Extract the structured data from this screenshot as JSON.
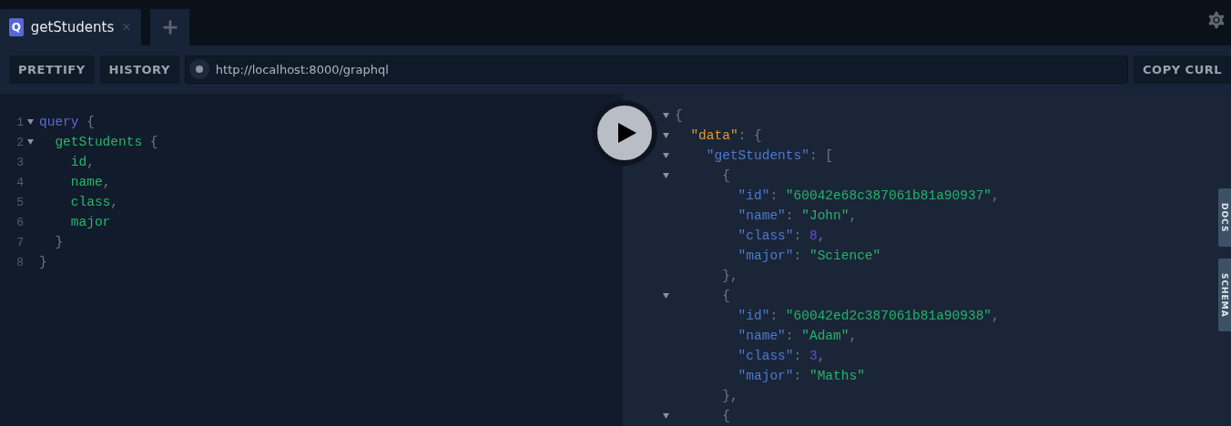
{
  "tabs": [
    {
      "badge": "Q",
      "label": "getStudents",
      "selected": true
    }
  ],
  "toolbar": {
    "buttons": [
      "PRETTIFY",
      "HISTORY"
    ],
    "url": "http://localhost:8000/graphql",
    "copy_button": "COPY CURL"
  },
  "query_editor": {
    "lines": [
      {
        "number": "1",
        "fold": true,
        "tokens": [
          {
            "kind": "keyword",
            "text": "query"
          },
          {
            "kind": "punct",
            "text": " {"
          }
        ]
      },
      {
        "number": "2",
        "fold": true,
        "tokens": [
          {
            "kind": "field",
            "text": "  getStudents"
          },
          {
            "kind": "punct",
            "text": " {"
          }
        ]
      },
      {
        "number": "3",
        "fold": false,
        "tokens": [
          {
            "kind": "field",
            "text": "    id"
          },
          {
            "kind": "punct",
            "text": ","
          }
        ]
      },
      {
        "number": "4",
        "fold": false,
        "tokens": [
          {
            "kind": "field",
            "text": "    name"
          },
          {
            "kind": "punct",
            "text": ","
          }
        ]
      },
      {
        "number": "5",
        "fold": false,
        "tokens": [
          {
            "kind": "field",
            "text": "    class"
          },
          {
            "kind": "punct",
            "text": ","
          }
        ]
      },
      {
        "number": "6",
        "fold": false,
        "tokens": [
          {
            "kind": "field",
            "text": "    major"
          }
        ]
      },
      {
        "number": "7",
        "fold": false,
        "tokens": [
          {
            "kind": "punct",
            "text": "  }"
          }
        ]
      },
      {
        "number": "8",
        "fold": false,
        "tokens": [
          {
            "kind": "punct",
            "text": "}"
          }
        ]
      }
    ]
  },
  "response": {
    "lines": [
      {
        "fold": true,
        "tokens": [
          {
            "kind": "punct",
            "text": "{"
          }
        ]
      },
      {
        "fold": true,
        "tokens": [
          {
            "kind": "rootkey",
            "text": "  \"data\""
          },
          {
            "kind": "punct",
            "text": ": {"
          }
        ]
      },
      {
        "fold": true,
        "tokens": [
          {
            "kind": "key",
            "text": "    \"getStudents\""
          },
          {
            "kind": "punct",
            "text": ": ["
          }
        ]
      },
      {
        "fold": true,
        "tokens": [
          {
            "kind": "punct",
            "text": "      {"
          }
        ]
      },
      {
        "fold": false,
        "tokens": [
          {
            "kind": "key",
            "text": "        \"id\""
          },
          {
            "kind": "punct",
            "text": ": "
          },
          {
            "kind": "string",
            "text": "\"60042e68c387061b81a90937\""
          },
          {
            "kind": "punct",
            "text": ","
          }
        ]
      },
      {
        "fold": false,
        "tokens": [
          {
            "kind": "key",
            "text": "        \"name\""
          },
          {
            "kind": "punct",
            "text": ": "
          },
          {
            "kind": "string",
            "text": "\"John\""
          },
          {
            "kind": "punct",
            "text": ","
          }
        ]
      },
      {
        "fold": false,
        "tokens": [
          {
            "kind": "key",
            "text": "        \"class\""
          },
          {
            "kind": "punct",
            "text": ": "
          },
          {
            "kind": "number",
            "text": "8"
          },
          {
            "kind": "punct",
            "text": ","
          }
        ]
      },
      {
        "fold": false,
        "tokens": [
          {
            "kind": "key",
            "text": "        \"major\""
          },
          {
            "kind": "punct",
            "text": ": "
          },
          {
            "kind": "string",
            "text": "\"Science\""
          }
        ]
      },
      {
        "fold": false,
        "tokens": [
          {
            "kind": "punct",
            "text": "      },"
          }
        ]
      },
      {
        "fold": true,
        "tokens": [
          {
            "kind": "punct",
            "text": "      {"
          }
        ]
      },
      {
        "fold": false,
        "tokens": [
          {
            "kind": "key",
            "text": "        \"id\""
          },
          {
            "kind": "punct",
            "text": ": "
          },
          {
            "kind": "string",
            "text": "\"60042ed2c387061b81a90938\""
          },
          {
            "kind": "punct",
            "text": ","
          }
        ]
      },
      {
        "fold": false,
        "tokens": [
          {
            "kind": "key",
            "text": "        \"name\""
          },
          {
            "kind": "punct",
            "text": ": "
          },
          {
            "kind": "string",
            "text": "\"Adam\""
          },
          {
            "kind": "punct",
            "text": ","
          }
        ]
      },
      {
        "fold": false,
        "tokens": [
          {
            "kind": "key",
            "text": "        \"class\""
          },
          {
            "kind": "punct",
            "text": ": "
          },
          {
            "kind": "number",
            "text": "3"
          },
          {
            "kind": "punct",
            "text": ","
          }
        ]
      },
      {
        "fold": false,
        "tokens": [
          {
            "kind": "key",
            "text": "        \"major\""
          },
          {
            "kind": "punct",
            "text": ": "
          },
          {
            "kind": "string",
            "text": "\"Maths\""
          }
        ]
      },
      {
        "fold": false,
        "tokens": [
          {
            "kind": "punct",
            "text": "      },"
          }
        ]
      },
      {
        "fold": true,
        "tokens": [
          {
            "kind": "punct",
            "text": "      {"
          }
        ]
      }
    ]
  },
  "side_tabs": [
    "DOCS",
    "SCHEMA"
  ]
}
